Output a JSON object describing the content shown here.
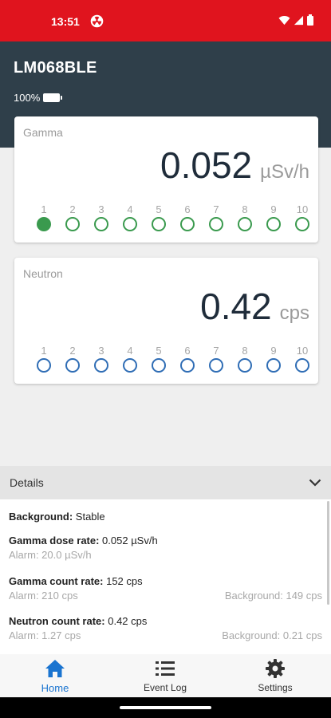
{
  "status_bar": {
    "time": "13:51",
    "bg_color": "#e0141e",
    "icons": [
      "radiation-icon",
      "wifi-icon",
      "signal-icon",
      "battery-icon"
    ]
  },
  "header": {
    "device_name": "LM068BLE",
    "battery_percent": "100%",
    "bg_color": "#2f3f4a"
  },
  "gamma": {
    "label": "Gamma",
    "value": "0.052",
    "unit": "µSv/h",
    "accent": "#3a9a4e",
    "levels": [
      "1",
      "2",
      "3",
      "4",
      "5",
      "6",
      "7",
      "8",
      "9",
      "10"
    ],
    "active_levels": 1
  },
  "neutron": {
    "label": "Neutron",
    "value": "0.42",
    "unit": "cps",
    "accent": "#2f6db5",
    "levels": [
      "1",
      "2",
      "3",
      "4",
      "5",
      "6",
      "7",
      "8",
      "9",
      "10"
    ],
    "active_levels": 0
  },
  "details": {
    "title": "Details",
    "background_label": "Background:",
    "background_value": " Stable",
    "gamma_dose_label": "Gamma dose rate:",
    "gamma_dose_value": " 0.052 µSv/h",
    "gamma_dose_alarm": "Alarm: 20.0 µSv/h",
    "gamma_count_label": "Gamma count rate:",
    "gamma_count_value": " 152 cps",
    "gamma_count_alarm": "Alarm: 210 cps",
    "gamma_count_background": "Background: 149 cps",
    "neutron_count_label": "Neutron count rate:",
    "neutron_count_value": " 0.42 cps",
    "neutron_count_alarm": "Alarm: 1.27 cps",
    "neutron_count_background": "Background: 0.21 cps"
  },
  "nav": {
    "home": "Home",
    "event_log": "Event Log",
    "settings": "Settings",
    "active_color": "#1a74d0"
  }
}
